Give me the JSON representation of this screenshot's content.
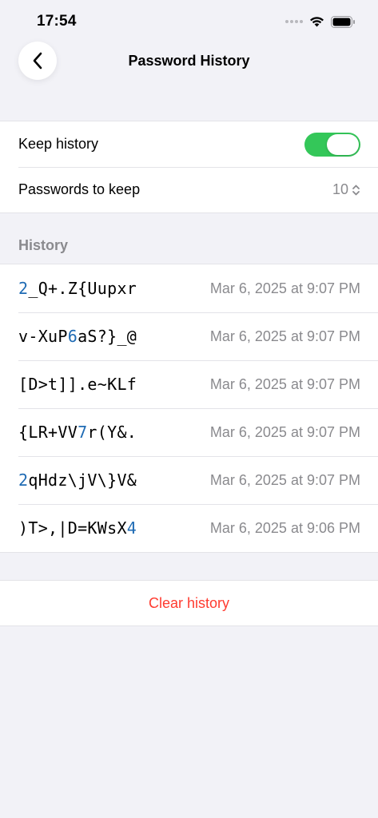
{
  "status_bar": {
    "time": "17:54",
    "icons": [
      "signal-icon",
      "wifi-icon",
      "battery-icon"
    ]
  },
  "nav": {
    "back_icon": "chevron-left-icon",
    "title": "Password History"
  },
  "settings": {
    "keep_history_label": "Keep history",
    "keep_history_on": true,
    "passwords_to_keep_label": "Passwords to keep",
    "passwords_to_keep_value": "10"
  },
  "history": {
    "header": "History",
    "items": [
      {
        "password": "2_Q+.Z{Uupxr",
        "date": "Mar 6, 2025 at 9:07 PM"
      },
      {
        "password": "v-XuP6aS?}_@",
        "date": "Mar 6, 2025 at 9:07 PM"
      },
      {
        "password": "[D>t]].e~KLf",
        "date": "Mar 6, 2025 at 9:07 PM"
      },
      {
        "password": "{LR+VV7r(Y&.",
        "date": "Mar 6, 2025 at 9:07 PM"
      },
      {
        "password": "2qHdz\\jV\\}V&",
        "date": "Mar 6, 2025 at 9:07 PM"
      },
      {
        "password": ")T>,|D=KWsX4",
        "date": "Mar 6, 2025 at 9:06 PM"
      }
    ]
  },
  "actions": {
    "clear_label": "Clear history"
  },
  "colors": {
    "accent_digit": "#1f6bb4",
    "toggle_on": "#34c759",
    "destructive": "#ff3b30",
    "background": "#f2f2f7"
  }
}
